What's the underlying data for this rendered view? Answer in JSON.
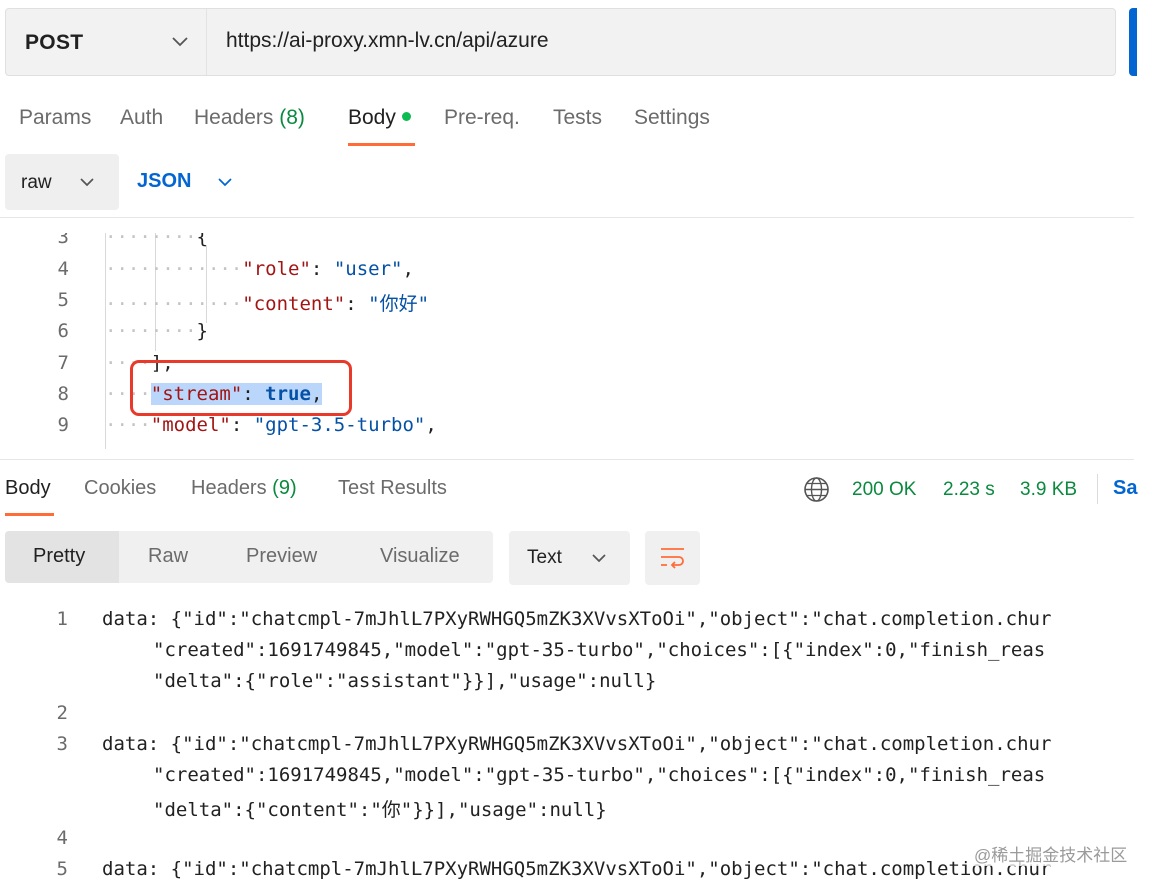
{
  "request": {
    "method": "POST",
    "url": "https://ai-proxy.xmn-lv.cn/api/azure"
  },
  "request_tabs": {
    "params": "Params",
    "auth": "Auth",
    "headers": "Headers",
    "headers_count": "(8)",
    "body": "Body",
    "prereq": "Pre-req.",
    "tests": "Tests",
    "settings": "Settings"
  },
  "body_mode": {
    "raw": "raw",
    "format": "JSON"
  },
  "editor": {
    "lines": [
      {
        "num": "3",
        "text": "{"
      },
      {
        "num": "4",
        "key": "\"role\"",
        "value": "\"user\""
      },
      {
        "num": "5",
        "key": "\"content\"",
        "value": "\"你好\""
      },
      {
        "num": "6",
        "text": "}"
      },
      {
        "num": "7",
        "text": "],"
      },
      {
        "num": "8",
        "key": "\"stream\"",
        "value": "true"
      },
      {
        "num": "9",
        "key": "\"model\"",
        "value": "\"gpt-3.5-turbo\""
      }
    ]
  },
  "response_tabs": {
    "body": "Body",
    "cookies": "Cookies",
    "headers": "Headers",
    "headers_count": "(9)",
    "test_results": "Test Results"
  },
  "response_status": {
    "code": "200 OK",
    "time": "2.23 s",
    "size": "3.9 KB",
    "save": "Sa"
  },
  "view_modes": {
    "pretty": "Pretty",
    "raw": "Raw",
    "preview": "Preview",
    "visualize": "Visualize",
    "text": "Text"
  },
  "response_body": {
    "lines": [
      {
        "num": "1",
        "text": "data: {\"id\":\"chatcmpl-7mJhlL7PXyRWHGQ5mZK3XVvsXToOi\",\"object\":\"chat.completion.chur"
      },
      {
        "num": "",
        "text": "\"created\":1691749845,\"model\":\"gpt-35-turbo\",\"choices\":[{\"index\":0,\"finish_reas"
      },
      {
        "num": "",
        "text": "\"delta\":{\"role\":\"assistant\"}}],\"usage\":null}"
      },
      {
        "num": "2",
        "text": ""
      },
      {
        "num": "3",
        "text": "data: {\"id\":\"chatcmpl-7mJhlL7PXyRWHGQ5mZK3XVvsXToOi\",\"object\":\"chat.completion.chur"
      },
      {
        "num": "",
        "text": "\"created\":1691749845,\"model\":\"gpt-35-turbo\",\"choices\":[{\"index\":0,\"finish_reas"
      },
      {
        "num": "",
        "text": "\"delta\":{\"content\":\"你\"}}],\"usage\":null}"
      },
      {
        "num": "4",
        "text": ""
      },
      {
        "num": "5",
        "text": "data: {\"id\":\"chatcmpl-7mJhlL7PXyRWHGQ5mZK3XVvsXToOi\",\"object\":\"chat.completion.chur"
      }
    ]
  },
  "watermark": "@稀土掘金技术社区",
  "colors": {
    "accent_orange": "#ff6c37",
    "status_green": "#0a8a3e",
    "link_blue": "#0265d2",
    "highlight_red": "#e8392b"
  },
  "icons": [
    "chevron-down-icon",
    "globe-icon",
    "wrap-lines-icon"
  ]
}
